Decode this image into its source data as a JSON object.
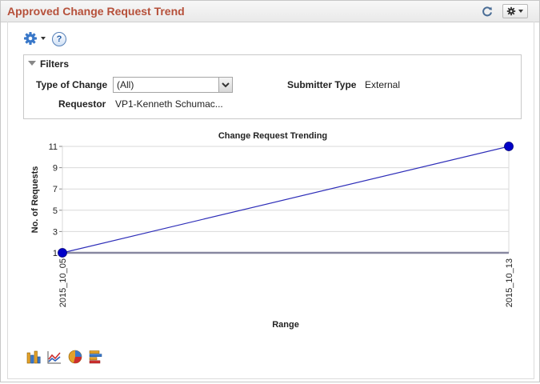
{
  "pagelet": {
    "title": "Approved Change Request Trend"
  },
  "filters": {
    "title": "Filters",
    "type_of_change_label": "Type of Change",
    "type_of_change_value": "(All)",
    "submitter_type_label": "Submitter Type",
    "submitter_type_value": "External",
    "requestor_label": "Requestor",
    "requestor_value": "VP1-Kenneth Schumac..."
  },
  "help": {
    "glyph": "?"
  },
  "colors": {
    "title": "#b6503a",
    "series_line": "#2d2db8",
    "series_point": "#0000c8",
    "baseline": "#8888a0",
    "grid": "#d9d9d9"
  },
  "chart_data": {
    "type": "line",
    "title": "Change Request Trending",
    "xlabel": "Range",
    "ylabel": "No. of Requests",
    "categories": [
      "2015_10_05",
      "2015_10_13"
    ],
    "series": [
      {
        "values": [
          1,
          11
        ]
      }
    ],
    "yticks": [
      1,
      3,
      5,
      7,
      9,
      11
    ],
    "ylim": [
      1,
      11
    ],
    "grid": true,
    "legend": "none"
  },
  "chart_type_icons": [
    "bar-chart-icon",
    "line-chart-icon",
    "pie-chart-icon",
    "horizontal-bar-chart-icon"
  ]
}
